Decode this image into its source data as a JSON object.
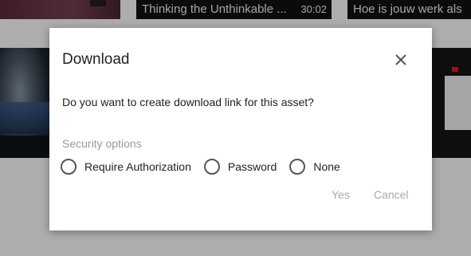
{
  "background": {
    "video_titles": [
      {
        "title": "Thinking the Unthinkable ...",
        "duration": "30:02"
      },
      {
        "title": "Hoe is jouw werk als"
      }
    ]
  },
  "dialog": {
    "title": "Download",
    "close_icon": "close-icon",
    "question": "Do you want to create download link for this asset?",
    "security_label": "Security options",
    "options": [
      {
        "label": "Require Authorization",
        "selected": false
      },
      {
        "label": "Password",
        "selected": false
      },
      {
        "label": "None",
        "selected": false
      }
    ],
    "yes_label": "Yes",
    "cancel_label": "Cancel"
  },
  "colors": {
    "overlay": "rgba(0,0,0,0.32)",
    "text": "#222222",
    "muted": "#9a9a9a",
    "disabled_button": "#aaaaaa"
  }
}
